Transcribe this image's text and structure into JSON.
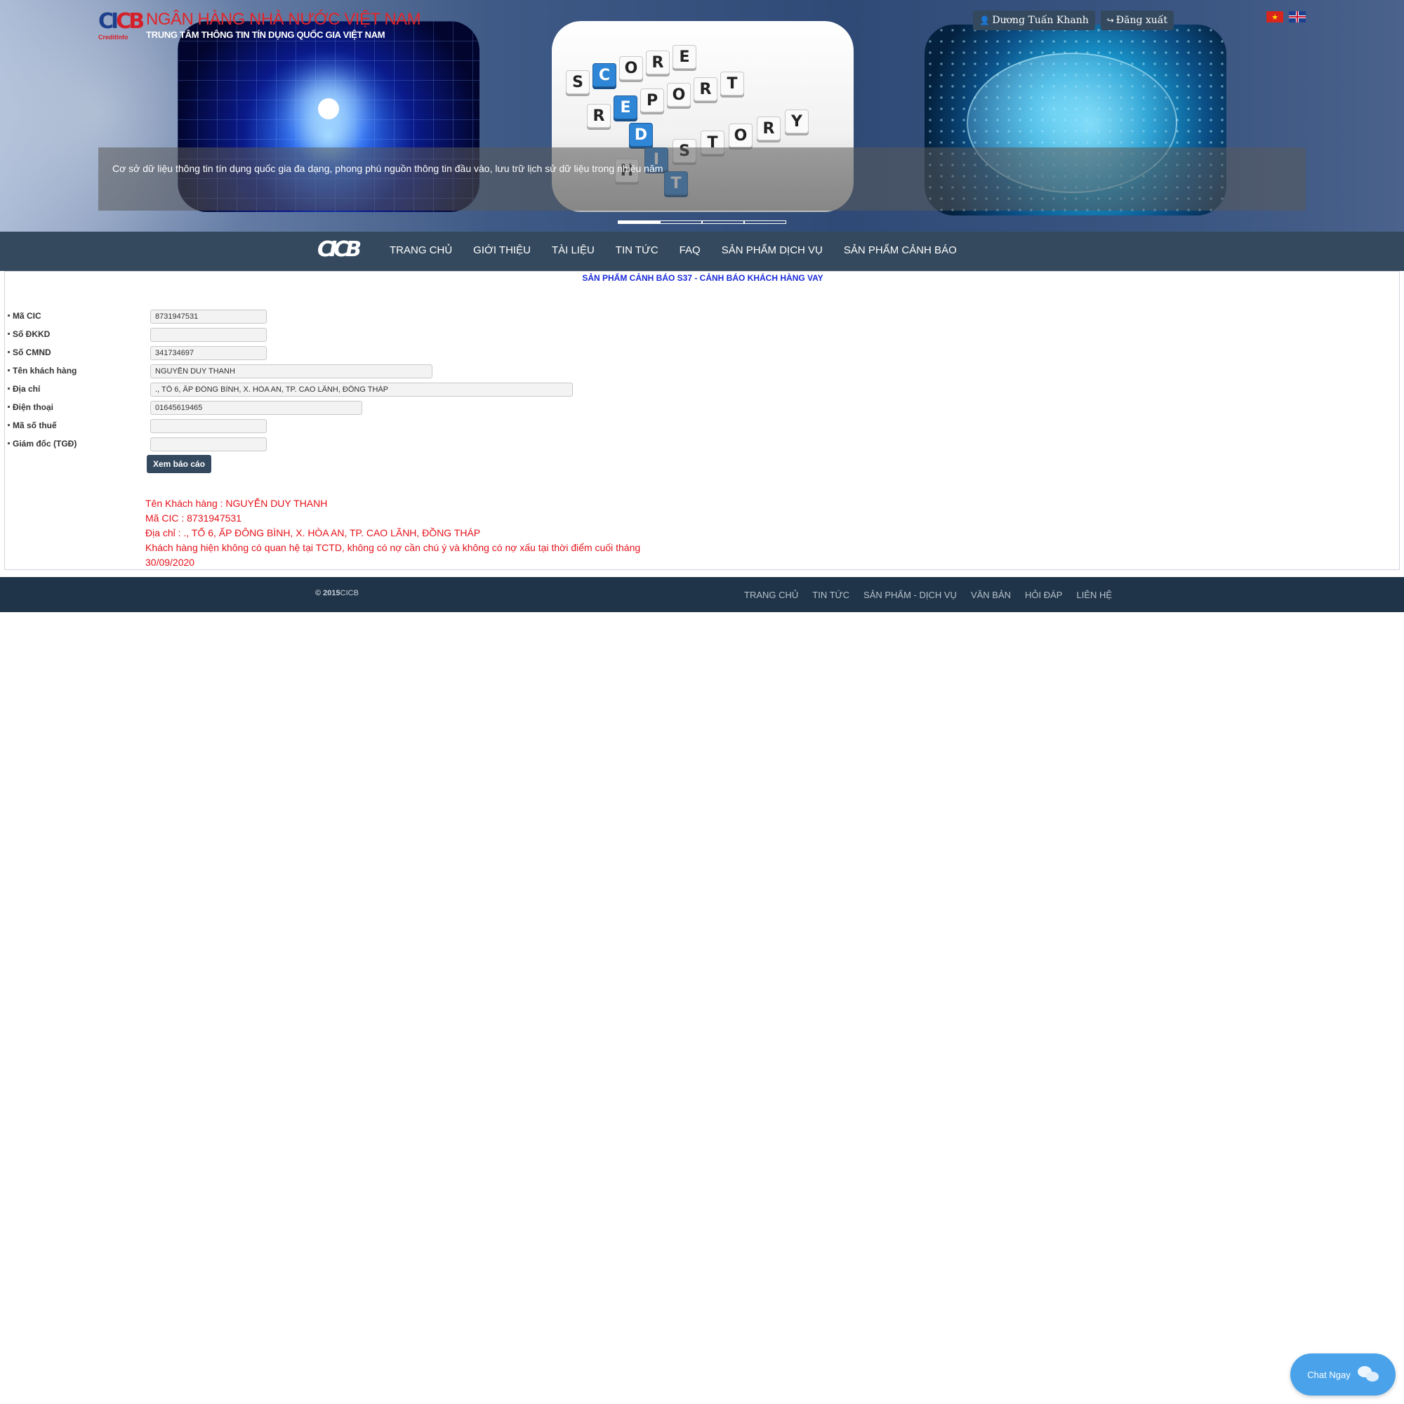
{
  "header": {
    "logo_brand": "CICB",
    "logo_sub": "CreditInfo",
    "logo_title": "NGÂN HÀNG NHÀ NƯỚC VIỆT NAM",
    "logo_subtitle": "TRUNG TÂM THÔNG TIN TÍN DỤNG QUỐC GIA VIỆT NAM",
    "user_name": "Dương Tuấn Khanh",
    "logout_label": "Đăng xuất",
    "languages": [
      "vi",
      "en"
    ]
  },
  "slider": {
    "caption": "Cơ sở dữ liệu thông tin tín dụng quốc gia đa dạng, phong phú nguồn thông tin đầu vào, lưu trữ lịch sử dữ liệu trong nhiều năm",
    "slides": [
      "data-network",
      "credit-crossword",
      "globe-network"
    ],
    "active_index": 0,
    "indicator_count": 4,
    "crossword_words": [
      "SCORE",
      "REPORT",
      "HISTORY",
      "CREDIT"
    ]
  },
  "nav": {
    "logo": "CICB",
    "items": [
      "TRANG CHỦ",
      "GIỚI THIỆU",
      "TÀI LIỆU",
      "TIN TỨC",
      "FAQ",
      "SẢN PHẨM DỊCH VỤ",
      "SẢN PHẨM CẢNH BÁO"
    ]
  },
  "page": {
    "title": "SẢN PHẨM CẢNH BÁO S37 - CẢNH BÁO KHÁCH HÀNG VAY"
  },
  "form": {
    "fields": [
      {
        "label": "Mã CIC",
        "value": "8731947531"
      },
      {
        "label": "Số ĐKKD",
        "value": ""
      },
      {
        "label": "Số CMND",
        "value": "341734697"
      },
      {
        "label": "Tên khách hàng",
        "value": "NGUYỄN DUY THANH"
      },
      {
        "label": "Địa chỉ",
        "value": "., TỔ 6, ẤP ĐÔNG BÌNH, X. HÒA AN, TP. CAO LÃNH, ĐỒNG THÁP"
      },
      {
        "label": "Điện thoại",
        "value": "01645619465"
      },
      {
        "label": "Mã số thuế",
        "value": ""
      },
      {
        "label": "Giám đốc (TGĐ)",
        "value": ""
      }
    ],
    "submit_label": "Xem báo cáo"
  },
  "result": {
    "customer_name": "Tên Khách hàng : NGUYỄN DUY THANH",
    "cic_code": "Mã CIC : 8731947531",
    "address": "Địa chỉ : ., TỔ 6, ẤP ĐÔNG BÌNH, X. HÒA AN, TP. CAO LÃNH, ĐỒNG THÁP",
    "message": "Khách hàng hiện không có quan hệ tại TCTD, không có nợ cần chú ý và không có nợ xấu tại thời điểm cuối tháng 30/09/2020"
  },
  "footer": {
    "copyright_year": "© 2015",
    "copyright_name": "CICB",
    "links": [
      "TRANG CHỦ",
      "TIN TỨC",
      "SẢN PHẨM - DỊCH VỤ",
      "VĂN BẢN",
      "HỎI ĐÁP",
      "LIÊN HỆ"
    ]
  },
  "chat": {
    "label": "Chat Ngay"
  },
  "colors": {
    "nav_bg": "#34495e",
    "footer_bg": "#1f3448",
    "title_blue": "#1a2bd8",
    "result_red": "#e4121a",
    "chat_blue": "#4aa3ea",
    "logo_red": "#e1252b"
  }
}
